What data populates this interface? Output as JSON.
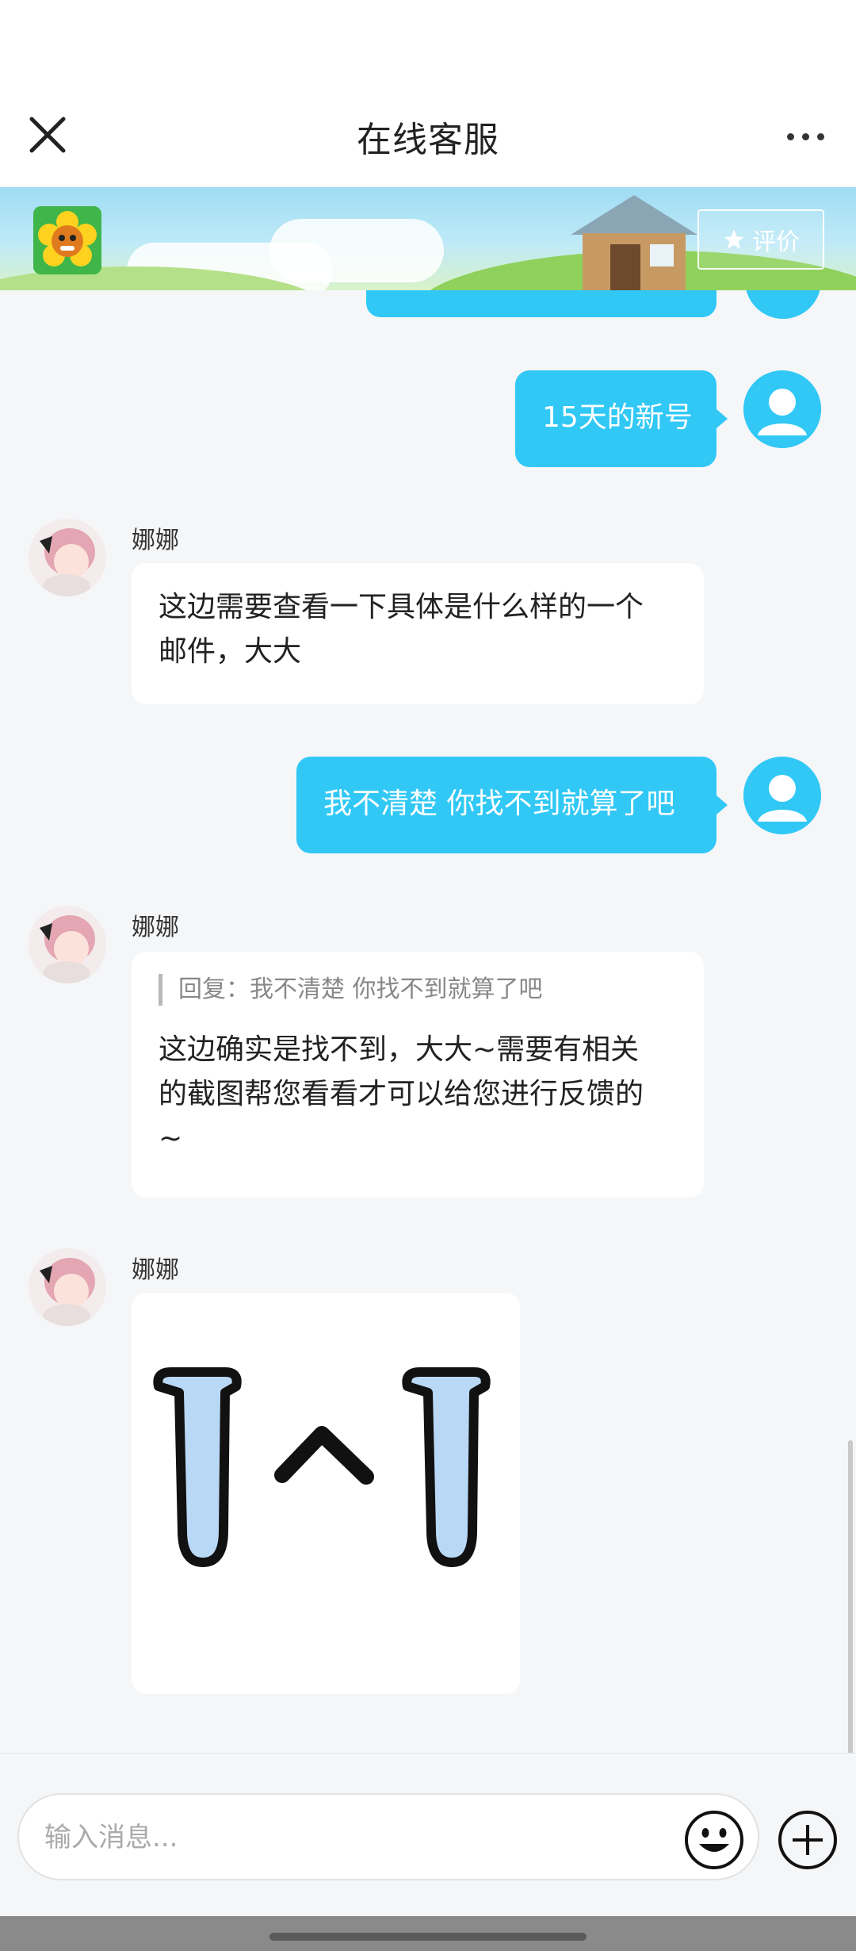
{
  "header": {
    "title": "在线客服"
  },
  "banner": {
    "rate_label": "评价"
  },
  "messages": [
    {
      "sender": "user",
      "text": "15天的新号"
    },
    {
      "sender": "agent",
      "name": "娜娜",
      "text_lines": [
        "这边需要查看一下具体是什么样的一个",
        "邮件，大大"
      ]
    },
    {
      "sender": "user",
      "text": "我不清楚 你找不到就算了吧"
    },
    {
      "sender": "agent",
      "name": "娜娜",
      "quote": "回复：我不清楚 你找不到就算了吧",
      "text_lines": [
        "这边确实是找不到，大大~需要有相关",
        "的截图帮您看看才可以给您进行反馈的",
        "~"
      ]
    },
    {
      "sender": "agent",
      "name": "娜娜",
      "type": "sticker",
      "sticker": "crying-face-sticker"
    }
  ],
  "input": {
    "placeholder": "输入消息..."
  },
  "icons": {
    "close": "close-icon",
    "more": "more-icon",
    "emoji": "emoji-icon",
    "plus": "plus-icon",
    "star": "star-icon"
  },
  "colors": {
    "accent": "#31c8f6",
    "agent_bubble": "#ffffff",
    "background": "#f5f6f8"
  }
}
